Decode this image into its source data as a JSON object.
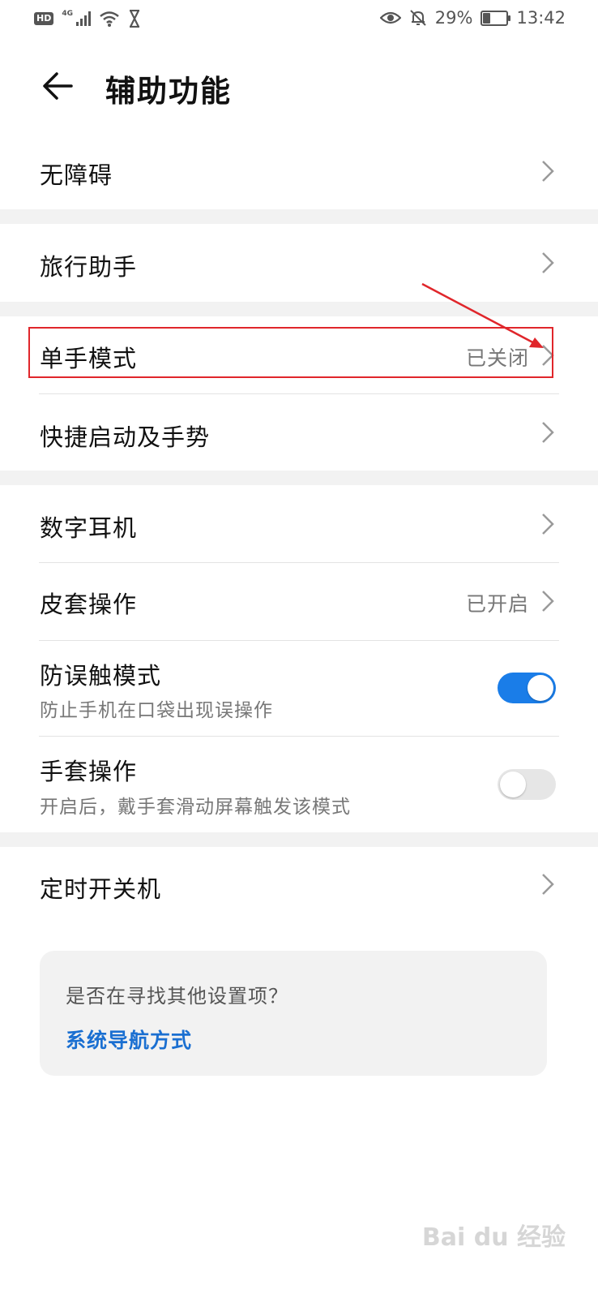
{
  "status_bar": {
    "hd": "HD",
    "network": "4G",
    "battery": "29%",
    "time": "13:42",
    "battery_level": 0.29
  },
  "header": {
    "title": "辅助功能"
  },
  "items": {
    "accessibility": {
      "label": "无障碍"
    },
    "travel_assistant": {
      "label": "旅行助手"
    },
    "one_hand_mode": {
      "label": "单手模式",
      "value": "已关闭"
    },
    "quick_launch": {
      "label": "快捷启动及手势"
    },
    "digital_earphone": {
      "label": "数字耳机"
    },
    "cover_operation": {
      "label": "皮套操作",
      "value": "已开启"
    },
    "accidental_touch": {
      "label": "防误触模式",
      "sub": "防止手机在口袋出现误操作",
      "enabled": true
    },
    "glove_mode": {
      "label": "手套操作",
      "sub": "开启后，戴手套滑动屏幕触发该模式",
      "enabled": false
    },
    "scheduled_power": {
      "label": "定时开关机"
    }
  },
  "suggestion_card": {
    "question": "是否在寻找其他设置项？",
    "link": "系统导航方式"
  },
  "colors": {
    "accent": "#1a7de8",
    "link": "#1a6fd1",
    "annotation": "#e0262b"
  },
  "watermark": "Bai du 经验"
}
